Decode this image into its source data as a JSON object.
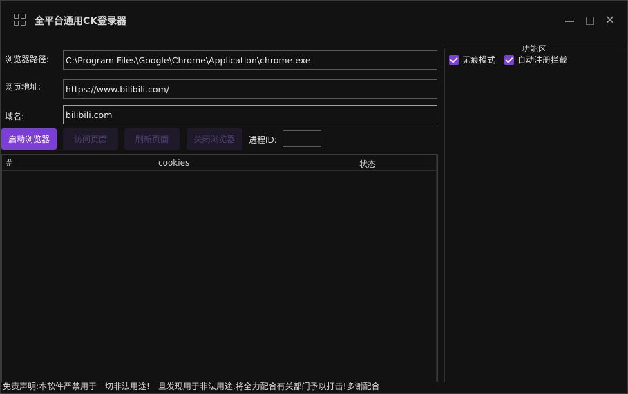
{
  "window": {
    "title": "全平台通用CK登录器",
    "icons": {
      "app": "grid-icon",
      "minimize": "minimize-icon",
      "maximize": "maximize-icon",
      "close": "close-icon"
    },
    "close_glyph": "✕"
  },
  "form": {
    "browser_path_label": "浏览器路径:",
    "browser_path_value": "C:\\Program Files\\Google\\Chrome\\Application\\chrome.exe",
    "url_label": "网页地址:",
    "url_value": "https://www.bilibili.com/",
    "domain_label": "域名:",
    "domain_value": "bilibili.com"
  },
  "toolbar": {
    "launch_label": "启动浏览器",
    "visit_label": "访问页面",
    "refresh_label": "刷新页面",
    "close_browser_label": "关闭浏览器",
    "pid_label": "进程ID:",
    "pid_value": ""
  },
  "table": {
    "columns": [
      "#",
      "cookies",
      "状态"
    ],
    "rows": []
  },
  "options": {
    "title": "功能区",
    "incognito_label": "无痕模式",
    "incognito_checked": true,
    "intercept_label": "自动注册拦截",
    "intercept_checked": true
  },
  "footer": {
    "disclaimer": "免责声明:本软件严禁用于一切非法用途!一旦发现用于非法用途,将全力配合有关部门予以打击!多谢配合"
  },
  "colors": {
    "background": "#121212",
    "accent": "#7b3fd6",
    "disabled_button": "#1f1a2a",
    "disabled_text": "#4e3e70"
  }
}
